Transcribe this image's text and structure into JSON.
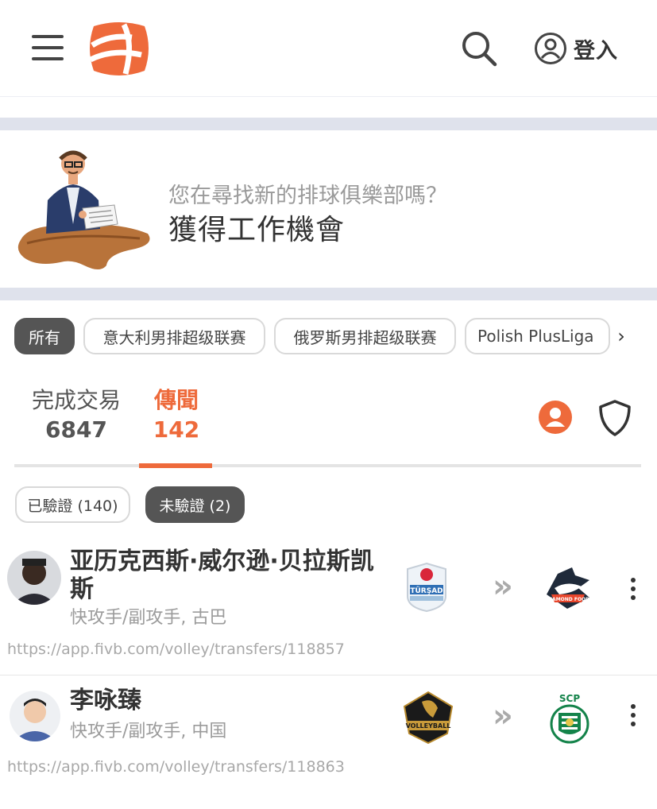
{
  "header": {
    "login_label": "登入",
    "accent": "#ee6a3b"
  },
  "banner": {
    "subtitle": "您在尋找新的排球俱樂部嗎？",
    "title": "獲得工作機會"
  },
  "filters": {
    "items": [
      "所有",
      "意大利男排超级联赛",
      "俄罗斯男排超级联赛",
      "Polish PlusLiga"
    ],
    "more_icon": "chevron-right-icon"
  },
  "stats": {
    "complete_label": "完成交易",
    "complete_count": "6847",
    "rumor_label": "傳聞",
    "rumor_count": "142"
  },
  "verify": {
    "verified_label": "已驗證 (140)",
    "unverified_label": "未驗證 (2)"
  },
  "transfers": [
    {
      "name": "亚历克西斯·威尔逊·贝拉斯凯斯",
      "position": "快攻手/副攻手, 古巴",
      "url": "https://app.fivb.com/volley/transfers/118857"
    },
    {
      "name": "李咏臻",
      "position": "快攻手/副攻手, 中国",
      "url": "https://app.fivb.com/volley/transfers/118863"
    }
  ]
}
